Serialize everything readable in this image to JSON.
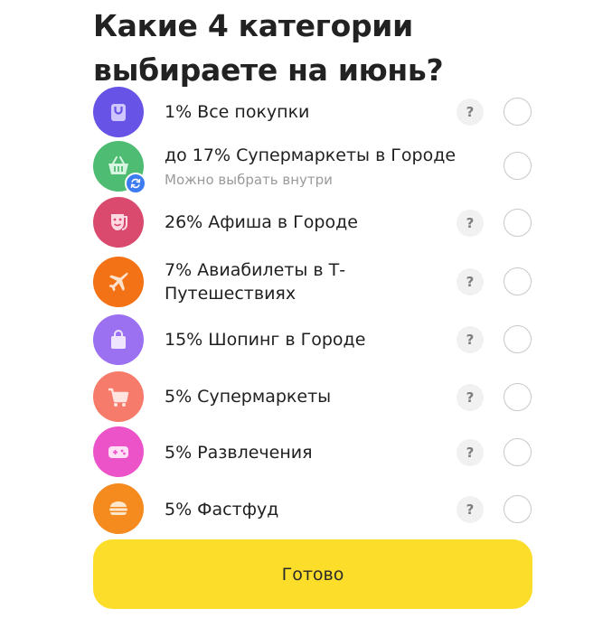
{
  "title": "Какие 4 категории выбираете на июнь?",
  "categories": [
    {
      "label": "1% Все покупки",
      "icon": "shopping-bag-icon",
      "color": "#6753e6",
      "help": "?"
    },
    {
      "label": "до 17% Супермаркеты в Городе",
      "sublabel": "Можно выбрать внутри",
      "icon": "basket-icon",
      "color": "#4ebc72",
      "badge_icon": "refresh-icon",
      "badge_color": "#3d7bf0"
    },
    {
      "label": "26% Афиша в Городе",
      "icon": "theater-mask-icon",
      "color": "#d94a6e",
      "help": "?"
    },
    {
      "label": "7% Авиабилеты в Т-Путешествиях",
      "icon": "airplane-icon",
      "color": "#f47216",
      "help": "?"
    },
    {
      "label": "15% Шопинг в Городе",
      "icon": "shopping-bag-icon",
      "color": "#9b71f2",
      "help": "?"
    },
    {
      "label": "5% Супермаркеты",
      "icon": "cart-icon",
      "color": "#f77b6a",
      "help": "?"
    },
    {
      "label": "5% Развлечения",
      "icon": "gamepad-icon",
      "color": "#ec53c8",
      "help": "?"
    },
    {
      "label": "5% Фастфуд",
      "icon": "burger-icon",
      "color": "#f58a1f",
      "help": "?"
    }
  ],
  "done_button": {
    "label": "Готово",
    "color": "#fcdd2a"
  }
}
